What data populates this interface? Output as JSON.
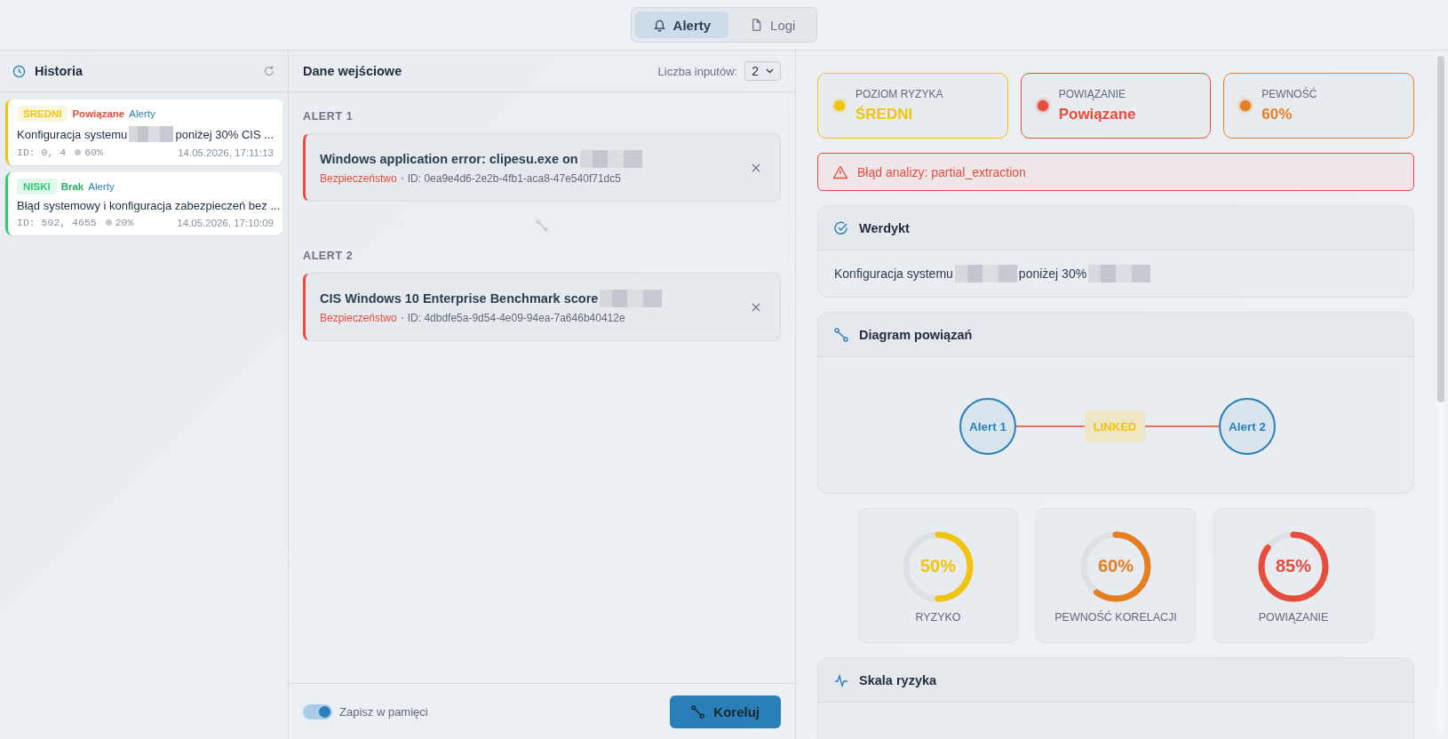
{
  "nav": {
    "tabs": [
      {
        "label": "Alerty",
        "selected": true
      },
      {
        "label": "Logi",
        "selected": false
      }
    ]
  },
  "history": {
    "title": "Historia",
    "items": [
      {
        "risk": {
          "label": "ŚREDNI",
          "color": "#f1c40f"
        },
        "relation": {
          "label": "Powiązane",
          "color": "#e74c3c"
        },
        "source": "Alerty",
        "text_parts": [
          {
            "kind": "text",
            "text": "Konfiguracja systemu"
          },
          {
            "kind": "redacted"
          },
          {
            "kind": "text",
            "text": "poniżej 30% CIS ..."
          }
        ],
        "ids": "ID: 0, 4",
        "confidence": "60%",
        "time": "14.05.2026, 17:11:13"
      },
      {
        "risk": {
          "label": "NISKI",
          "color": "#2ecc71"
        },
        "relation": {
          "label": "Brak",
          "color": "#27ae60"
        },
        "source": "Alerty",
        "text_parts": [
          {
            "kind": "text",
            "text": "Błąd systemowy i konfiguracja zabezpieczeń bez ..."
          }
        ],
        "ids": "ID: 502, 4655",
        "confidence": "20%",
        "time": "14.05.2026, 17:10:09"
      }
    ]
  },
  "input": {
    "title": "Dane wejściowe",
    "count_label": "Liczba inputów:",
    "count_value": "2",
    "alerts": [
      {
        "label": "ALERT 1",
        "title_parts": [
          {
            "kind": "text",
            "text": "Windows application error: clipesu.exe on"
          },
          {
            "kind": "redacted"
          }
        ],
        "category": "Bezpieczeństwo",
        "id": "ID: 0ea9e4d6-2e2b-4fb1-aca8-47e540f71dc5"
      },
      {
        "label": "ALERT 2",
        "title_parts": [
          {
            "kind": "text",
            "text": "CIS Windows 10 Enterprise Benchmark score"
          },
          {
            "kind": "redacted"
          }
        ],
        "category": "Bezpieczeństwo",
        "id": "ID: 4dbdfe5a-9d54-4e09-94ea-7a646b40412e"
      }
    ],
    "save_toggle": {
      "label": "Zapisz w pamięci",
      "on": true
    },
    "button": "Koreluj"
  },
  "result": {
    "summary": [
      {
        "label": "POZIOM RYZYKA",
        "value": "ŚREDNI",
        "color": "#f1c40f"
      },
      {
        "label": "POWIĄZANIE",
        "value": "Powiązane",
        "color": "#e74c3c"
      },
      {
        "label": "PEWNOŚĆ",
        "value": "60%",
        "color": "#e67e22"
      }
    ],
    "error": "Błąd analizy: partial_extraction",
    "verdict": {
      "title": "Werdykt",
      "text_parts": [
        {
          "kind": "text",
          "text": "Konfiguracja systemu"
        },
        {
          "kind": "redacted"
        },
        {
          "kind": "text",
          "text": "poniżej 30%"
        },
        {
          "kind": "redacted"
        }
      ]
    },
    "diagram": {
      "title": "Diagram powiązań",
      "nodes": [
        "Alert 1",
        "Alert 2"
      ],
      "edge_label": "LINKED"
    },
    "gauges": [
      {
        "value": "50%",
        "label": "RYZYKO",
        "level": 0.5,
        "color": "#f1c40f"
      },
      {
        "value": "60%",
        "label": "PEWNOŚĆ KORELACJI",
        "level": 0.6,
        "color": "#e67e22"
      },
      {
        "value": "85%",
        "label": "POWIĄZANIE",
        "level": 0.85,
        "color": "#e74c3c"
      }
    ],
    "scale": {
      "title": "Skala ryzyka"
    }
  }
}
